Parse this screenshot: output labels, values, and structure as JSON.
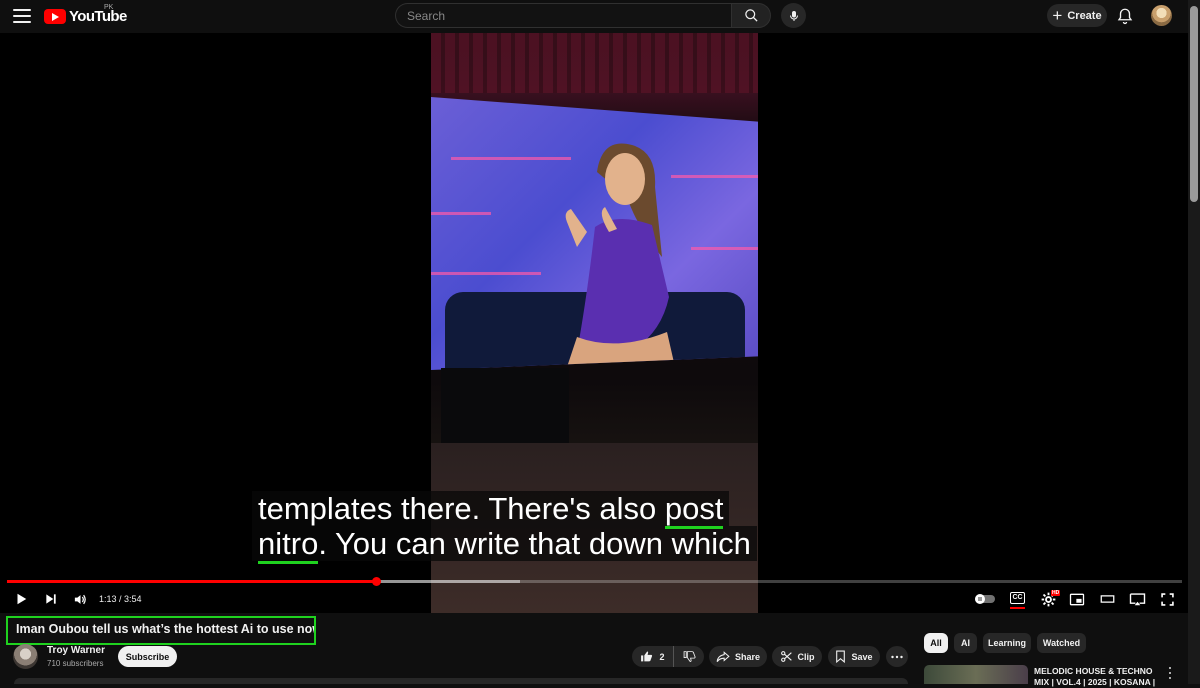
{
  "header": {
    "logo_text": "YouTube",
    "country_code": "PK",
    "search_placeholder": "Search",
    "create_label": "Create"
  },
  "player": {
    "subtitle_lines": [
      {
        "before": "templates there. There's also ",
        "highlight": "post",
        "after": ""
      },
      {
        "before": "",
        "highlight": "nitro",
        "after": ". You can write that down which"
      }
    ],
    "time_current": "1:13",
    "time_total": "3:54",
    "progress_played_fraction": 0.314,
    "progress_buffered_fraction": 0.437,
    "cc_label": "CC",
    "hd_badge": "HD",
    "colors": {
      "progress": "#ff0000",
      "highlight_border": "#1fd21f"
    }
  },
  "video": {
    "title": "Iman Oubou tell us what’s the hottest Ai to use now"
  },
  "channel": {
    "name": "Troy Warner",
    "subscribers": "710 subscribers",
    "subscribe_label": "Subscribe"
  },
  "actions": {
    "like_count": "2",
    "share_label": "Share",
    "clip_label": "Clip",
    "save_label": "Save"
  },
  "chips": [
    "All",
    "AI",
    "Learning",
    "Watched"
  ],
  "recommendation": {
    "title": "MELODIC HOUSE & TECHNO MIX | VOL.4 | 2025 | KOSANA |"
  }
}
